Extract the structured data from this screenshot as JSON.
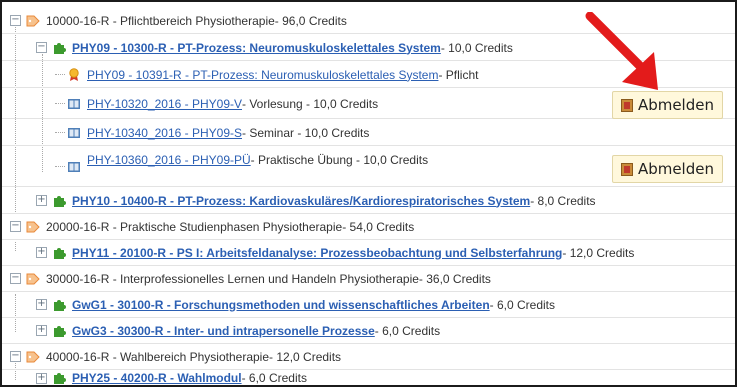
{
  "rows": [
    {
      "toggle": "−",
      "icon": "tag-icon",
      "label": "10000-16-R - Pflichtbereich Physiotherapie",
      "suffix": " - 96,0 Credits"
    },
    {
      "toggle": "−",
      "icon": "puzzle-icon",
      "label": "PHY09 - 10300-R - PT-Prozess: Neuromuskuloskelettales System",
      "suffix": " - 10,0 Credits"
    },
    {
      "icon": "award-icon",
      "label": "PHY09 - 10391-R - PT-Prozess: Neuromuskuloskelettales System",
      "suffix": " - Pflicht"
    },
    {
      "icon": "book-icon",
      "label": "PHY-10320_2016 - PHY09-V",
      "suffix": " - Vorlesung - 10,0 Credits"
    },
    {
      "icon": "book-icon",
      "label": "PHY-10340_2016 - PHY09-S",
      "suffix": " - Seminar - 10,0 Credits"
    },
    {
      "icon": "book-icon",
      "label": "PHY-10360_2016 - PHY09-PÜ",
      "suffix": " - Praktische Übung - 10,0 Credits"
    },
    {
      "toggle": "+",
      "icon": "puzzle-icon",
      "label": "PHY10 - 10400-R - PT-Prozess: Kardiovaskuläres/Kardiorespiratorisches System",
      "suffix": " - 8,0 Credits"
    },
    {
      "toggle": "−",
      "icon": "tag-icon",
      "label": "20000-16-R - Praktische Studienphasen Physiotherapie",
      "suffix": " - 54,0 Credits"
    },
    {
      "toggle": "+",
      "icon": "puzzle-icon",
      "label": "PHY11 - 20100-R - PS I: Arbeitsfeldanalyse: Prozessbeobachtung und Selbsterfahrung",
      "suffix": " - 12,0 Credits"
    },
    {
      "toggle": "−",
      "icon": "tag-icon",
      "label": "30000-16-R - Interprofessionelles Lernen und Handeln Physiotherapie",
      "suffix": " - 36,0 Credits"
    },
    {
      "toggle": "+",
      "icon": "puzzle-icon",
      "label": "GwG1 - 30100-R - Forschungsmethoden und wissenschaftliches Arbeiten",
      "suffix": " - 6,0 Credits"
    },
    {
      "toggle": "+",
      "icon": "puzzle-icon",
      "label": "GwG3 - 30300-R - Inter- und intrapersonelle Prozesse",
      "suffix": " - 6,0 Credits"
    },
    {
      "toggle": "−",
      "icon": "tag-icon",
      "label": "40000-16-R - Wahlbereich Physiotherapie",
      "suffix": " - 12,0 Credits"
    },
    {
      "toggle": "+",
      "icon": "puzzle-icon",
      "label": "PHY25 - 40200-R - Wahlmodul",
      "suffix": " - 6,0 Credits"
    }
  ],
  "actions": {
    "abmelden_label": "Abmelden"
  },
  "colors": {
    "link": "#2b5fb3",
    "puzzle": "#3c9a2e",
    "tag": "#e8893a",
    "arrow": "#e31b1b"
  }
}
